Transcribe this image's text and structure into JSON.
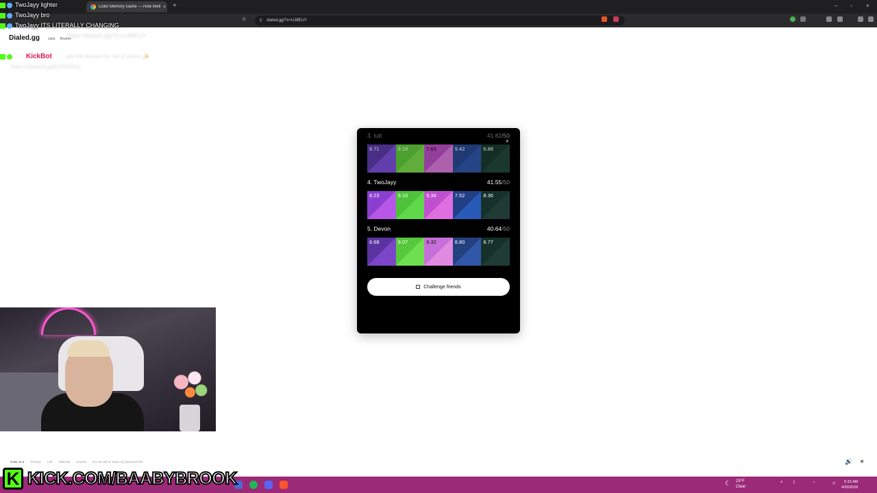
{
  "browser": {
    "tab_title": "Color Memory Game — How Well Can You See Color?",
    "tab_close": "×",
    "new_tab": "+",
    "url": "dialed.gg/?c=UJ8EUY",
    "win_min": "–",
    "win_max": "▫",
    "win_close": "×"
  },
  "chat": {
    "lines": [
      {
        "user": "TwoJayy",
        "text": "lighter"
      },
      {
        "user": "TwoJayy",
        "text": "bro"
      },
      {
        "user": "TwoJayy",
        "text": "ITS LITERALLY CHANGING"
      }
    ],
    "faint_link_1": "https://dialed.gg/?c=UJ8EUY",
    "kickbot_name": "KickBot",
    "kickbot_text": "join the discord for fun & chaos ✨",
    "kickbot_link": "https://discord.gg/6J3nERcLt"
  },
  "site": {
    "logo": "Dialed.gg",
    "nav_color": "color",
    "nav_2": "Rooms"
  },
  "modal": {
    "close": "×",
    "entries": [
      {
        "name": "3. tutt",
        "score": "41.82",
        "max": "/50",
        "swatches": [
          {
            "value": "8.71",
            "guess": "#7b4fd9",
            "target": "#5a3aa8"
          },
          {
            "value": "9.18",
            "guess": "#7ad94a",
            "target": "#5fc93a"
          },
          {
            "value": "7.63",
            "guess": "#d97ad9",
            "target": "#b94fc4"
          },
          {
            "value": "9.42",
            "guess": "#2f56a8",
            "target": "#274890"
          },
          {
            "value": "6.88",
            "guess": "#22463a",
            "target": "#1a3a30"
          }
        ]
      },
      {
        "name": "4. TwoJayy",
        "score": "41.55",
        "max": "/50",
        "swatches": [
          {
            "value": "8.23",
            "guess": "#b657e8",
            "target": "#8a3fd0"
          },
          {
            "value": "9.10",
            "guess": "#5fd84a",
            "target": "#4ec23b"
          },
          {
            "value": "9.34",
            "guess": "#de6fe0",
            "target": "#c050d0"
          },
          {
            "value": "7.52",
            "guess": "#2a5ab8",
            "target": "#223f86"
          },
          {
            "value": "8.36",
            "guess": "#1f3b33",
            "target": "#16302a"
          }
        ]
      },
      {
        "name": "5. Devon",
        "score": "40.64",
        "max": "/50",
        "swatches": [
          {
            "value": "6.68",
            "guess": "#7b45c8",
            "target": "#5b33a0"
          },
          {
            "value": "9.07",
            "guess": "#6ee050",
            "target": "#55c83c"
          },
          {
            "value": "9.32",
            "guess": "#e08ae0",
            "target": "#c66fd8"
          },
          {
            "value": "8.80",
            "guess": "#3157a8",
            "target": "#23407f"
          },
          {
            "value": "6.77",
            "guess": "#1e3c33",
            "target": "#16302a"
          }
        ]
      }
    ],
    "challenge_label": "Challenge friends"
  },
  "footer": {
    "version": "Color v1.4",
    "links": [
      "Privacy",
      "Lab",
      "Sitemap",
      "Socials",
      "Do not sell or share my personal info"
    ]
  },
  "kick": {
    "logo_letter": "K",
    "url": "KICK.COM/BAABYBROOK"
  },
  "taskbar": {
    "weather_temp": "29°F",
    "weather_desc": "Clear",
    "time": "5:15 AM",
    "date": "4/20/2026"
  },
  "colors": {
    "taskbar": "#9b2a78",
    "kick_green": "#53fc18",
    "modal_bg": "#000000"
  }
}
